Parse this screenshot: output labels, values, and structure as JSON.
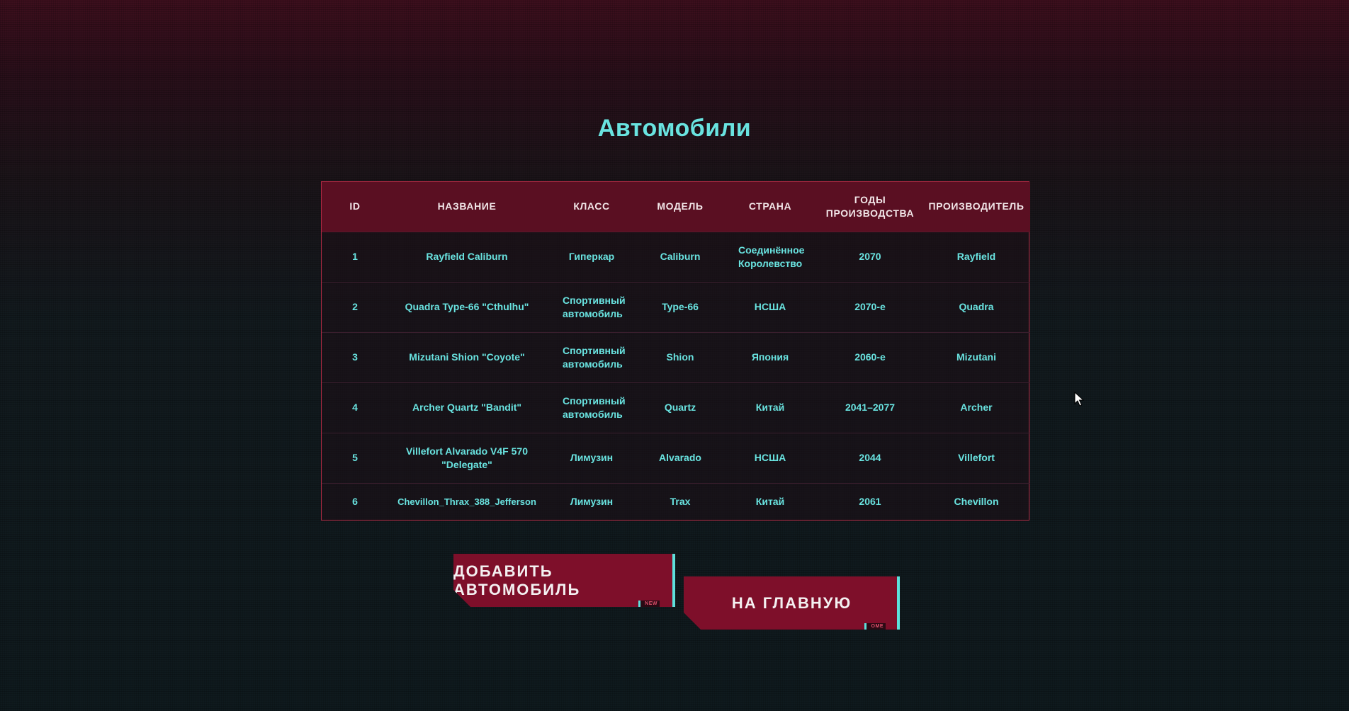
{
  "page": {
    "title": "Автомобили"
  },
  "table": {
    "headers": {
      "id": "ID",
      "name": "НАЗВАНИЕ",
      "class": "КЛАСС",
      "model": "МОДЕЛЬ",
      "country": "СТРАНА",
      "years_line1": "ГОДЫ",
      "years_line2": "ПРОИЗВОДСТВА",
      "maker": "ПРОИЗВОДИТЕЛЬ"
    },
    "rows": [
      {
        "id": "1",
        "name": "Rayfield Caliburn",
        "class": "Гиперкар",
        "model": "Caliburn",
        "country": "Соединённое Королевство",
        "years": "2070",
        "maker": "Rayfield"
      },
      {
        "id": "2",
        "name": "Quadra Type-66 \"Cthulhu\"",
        "class": "Спортивный автомобиль",
        "model": "Type-66",
        "country": "НСША",
        "years": "2070-е",
        "maker": "Quadra"
      },
      {
        "id": "3",
        "name": "Mizutani Shion \"Coyote\"",
        "class": "Спортивный автомобиль",
        "model": "Shion",
        "country": "Япония",
        "years": "2060-е",
        "maker": "Mizutani"
      },
      {
        "id": "4",
        "name": "Archer Quartz \"Bandit\"",
        "class": "Спортивный автомобиль",
        "model": "Quartz",
        "country": "Китай",
        "years": "2041–2077",
        "maker": "Archer"
      },
      {
        "id": "5",
        "name": "Villefort Alvarado V4F 570 \"Delegate\"",
        "class": "Лимузин",
        "model": "Alvarado",
        "country": "НСША",
        "years": "2044",
        "maker": "Villefort"
      },
      {
        "id": "6",
        "name": "Chevillon_Thrax_388_Jefferson",
        "class": "Лимузин",
        "model": "Trax",
        "country": "Китай",
        "years": "2061",
        "maker": "Chevillon"
      }
    ]
  },
  "buttons": {
    "add_label": "ДОБАВИТЬ АВТОМОБИЛЬ",
    "add_tag": "NEW",
    "home_label": "НА ГЛАВНУЮ",
    "home_tag": "OME"
  },
  "colors": {
    "accent_cyan": "#69e3e0",
    "button_red": "#7e0f2a",
    "header_red": "#5a0f22",
    "border_red": "#b32a44"
  }
}
